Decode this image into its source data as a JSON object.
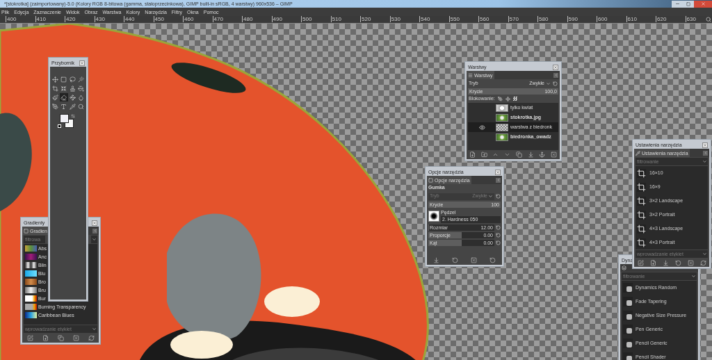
{
  "window": {
    "title": "*[stokrotka] (zaimportowany)-5.0 (Kolory RGB 8-bitowa (gamma, stałoprzecinkowa), GIMP built-in sRGB, 4 warstwy) 960x536 – GIMP"
  },
  "menu": [
    "Plik",
    "Edycja",
    "Zaznaczenie",
    "Widok",
    "Obraz",
    "Warstwa",
    "Kolory",
    "Narzędzia",
    "Filtry",
    "Okna",
    "Pomoc"
  ],
  "ruler": {
    "labels": [
      "400",
      "410",
      "420",
      "430",
      "440",
      "450",
      "460",
      "470",
      "480",
      "490",
      "500",
      "510",
      "520",
      "530",
      "540",
      "550",
      "560",
      "570",
      "580",
      "590",
      "600",
      "610",
      "620",
      "630"
    ]
  },
  "toolbox": {
    "title": "Przybornik",
    "tools": [
      {
        "selected": false
      },
      {
        "selected": false
      },
      {
        "selected": false
      },
      {
        "selected": false
      },
      {
        "selected": false
      },
      {
        "selected": false
      },
      {
        "selected": false
      },
      {
        "selected": false
      },
      {
        "selected": false
      },
      {
        "selected": true
      },
      {
        "selected": false
      },
      {
        "selected": false
      },
      {
        "selected": false
      },
      {
        "selected": false
      },
      {
        "selected": false
      },
      {
        "selected": false
      }
    ]
  },
  "gradients": {
    "title": "Gradienty",
    "tab": "Gradien",
    "filter_placeholder": "filtrowa",
    "items": [
      {
        "name": "Abs"
      },
      {
        "name": "Anc"
      },
      {
        "name": "Blin"
      },
      {
        "name": "Blu"
      },
      {
        "name": "Bro"
      },
      {
        "name": "Bru"
      },
      {
        "name": "Bur"
      },
      {
        "name": "Burning Transparency"
      },
      {
        "name": "Caribbean Blues"
      }
    ],
    "tag_placeholder": "wprowadzanie etykiet"
  },
  "layers": {
    "title": "Warstwy",
    "tab": "Warstwy",
    "mode_label": "Tryb",
    "mode": "Zwykłe",
    "opacity": {
      "label": "Krycie",
      "value": "100,0",
      "level": 1
    },
    "lock_label": "Blokowanie:",
    "items": [
      {
        "name": "tylko kwiat",
        "visible": false,
        "selected": false,
        "bold": false,
        "kind": "flower"
      },
      {
        "name": "stokrotka.jpg",
        "visible": false,
        "selected": false,
        "bold": true,
        "kind": "photo"
      },
      {
        "name": "warstwa z biedronk",
        "visible": true,
        "selected": true,
        "bold": false,
        "kind": "transparent"
      },
      {
        "name": "biedronka_owadz",
        "visible": false,
        "selected": false,
        "bold": true,
        "kind": "photo"
      }
    ]
  },
  "tool_options": {
    "title": "Opcje narzędzia",
    "tab": "Opcje narzędzia",
    "tool": "Gumka",
    "mode_label": "Tryb",
    "mode": "Zwykłe",
    "mode_disabled": true,
    "opacity": {
      "label": "Krycie",
      "value": "100",
      "level": 1
    },
    "brush_label": "Pędzel",
    "brush": "2. Hardness 050",
    "sliders": [
      {
        "label": "Rozmiar",
        "value": "12.00",
        "level": 0.01
      },
      {
        "label": "Proporcje",
        "value": "0.00",
        "level": 0.5
      },
      {
        "label": "Kąt",
        "value": "0.00",
        "level": 0.5
      }
    ]
  },
  "tool_presets": {
    "title": "Ustawienia narzędzia",
    "tab": "Ustawienia narzędzia",
    "filter_placeholder": "filtrowanie",
    "items": [
      "16×10",
      "16×9",
      "3×2 Landscape",
      "3×2 Portrait",
      "4×3 Landscape",
      "4×3 Portrait"
    ],
    "tag_placeholder": "wprowadzanie etykiet"
  },
  "dynamics": {
    "title": "Dyna",
    "filter_placeholder": "filtrowanie",
    "items": [
      "Dynamics Random",
      "Fade Tapering",
      "Negative Size Pressure",
      "Pen Generic",
      "Pencil Generic",
      "Pencil Shader"
    ]
  }
}
